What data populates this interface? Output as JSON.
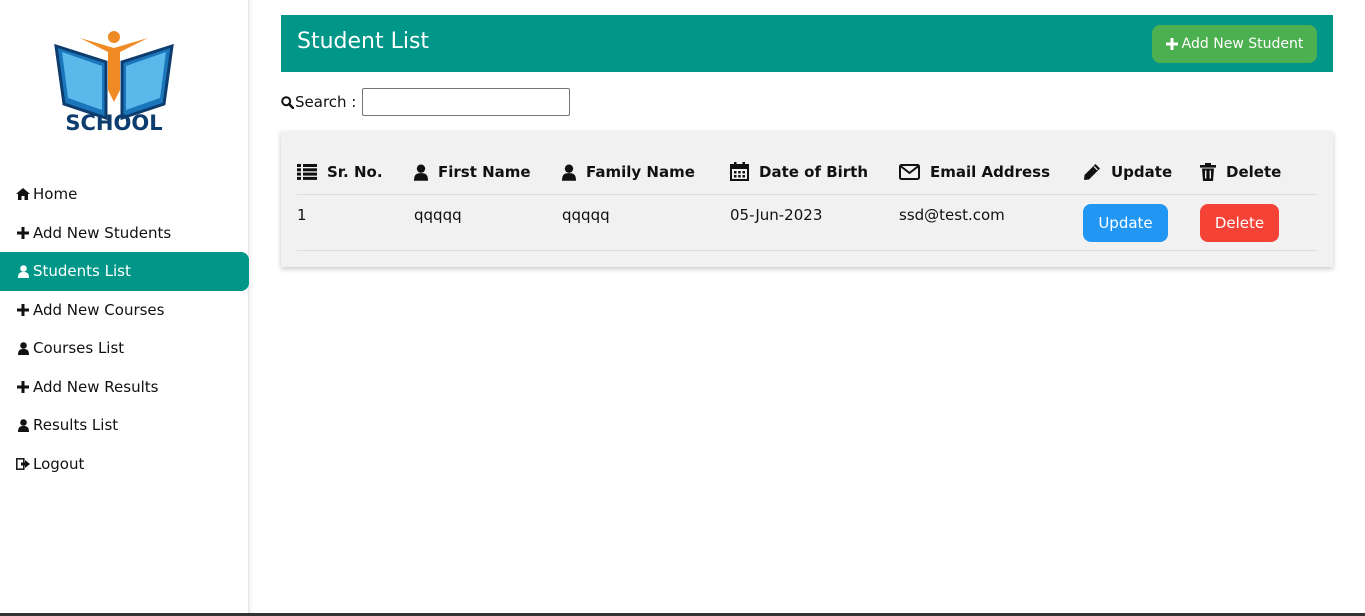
{
  "sidebar": {
    "logo_text": "SCHOOL",
    "items": [
      {
        "label": "Home",
        "icon": "home-icon"
      },
      {
        "label": "Add New Students",
        "icon": "plus-icon"
      },
      {
        "label": "Students List",
        "icon": "user-icon",
        "active": true
      },
      {
        "label": "Add New Courses",
        "icon": "plus-icon"
      },
      {
        "label": "Courses List",
        "icon": "user-icon"
      },
      {
        "label": "Add New Results",
        "icon": "plus-icon"
      },
      {
        "label": "Results List",
        "icon": "user-icon"
      },
      {
        "label": "Logout",
        "icon": "sign-out-icon"
      }
    ]
  },
  "header": {
    "title": "Student List",
    "add_button_label": "Add New Student"
  },
  "search": {
    "label": "Search :",
    "value": ""
  },
  "table": {
    "columns": [
      {
        "label": "Sr. No.",
        "icon": "list-icon"
      },
      {
        "label": "First Name",
        "icon": "user-icon"
      },
      {
        "label": "Family Name",
        "icon": "user-icon"
      },
      {
        "label": "Date of Birth",
        "icon": "calendar-icon"
      },
      {
        "label": "Email Address",
        "icon": "envelope-icon"
      },
      {
        "label": "Update",
        "icon": "pencil-icon"
      },
      {
        "label": "Delete",
        "icon": "trash-icon"
      }
    ],
    "rows": [
      {
        "sr": "1",
        "first_name": "qqqqq",
        "family_name": "qqqqq",
        "dob": "05-Jun-2023",
        "email": "ssd@test.com",
        "update_label": "Update",
        "delete_label": "Delete"
      }
    ]
  },
  "colors": {
    "accent": "#009688",
    "add_button": "#4caf50",
    "update_button": "#2196f3",
    "delete_button": "#f44336"
  }
}
